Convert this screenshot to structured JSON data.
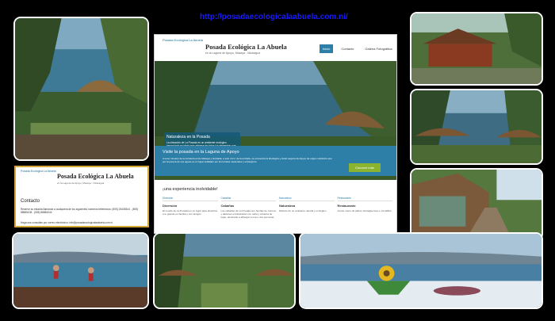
{
  "collage_url": "http://posadaecologicalaabuela.com.ni/",
  "website": {
    "top_line": "Posada Ecológica La Abuela",
    "title": "Posada Ecológica La Abuela",
    "subtitle": "en la Laguna de Apoyo, Masaya - Nicaragua",
    "nav": [
      "Inicio",
      "Contacto",
      "Galería Fotográfica"
    ],
    "hero_box": {
      "heading": "Naturaleza en la Posada",
      "text": "La ubicación de La Posada en un ambiente ecológico inmaculado es ideal para alejarse de todos los elementos que producen cansancio y estrés. Cuando esté aquí, olvidará"
    },
    "band": {
      "heading": "Visite la posada en la Laguna de Apoyo",
      "text": "A unos minutos de la carretera entre Masaya y Granada, a solo 4 km. de la entrada, se encuentra la Ecológica y Hotel Laguna de Apoyo de origen volcánico que por la pureza de sus aguas es un lugar señalado por los turistas nacionales y extranjeros.",
      "button": "Conocer más"
    },
    "experience_heading": "¡una experiencia inolvidable!",
    "columns": [
      {
        "category": "Diversión",
        "title": "Diversión",
        "text": "El muelle de La Posada es un lugar para divertirse a lo grande en familia y con amigos"
      },
      {
        "category": "Cabañas",
        "title": "Cabañas",
        "text": "Las cabañas de La Posada son hechas de troncos y tablones entrelazados con caña y cubierta de tejas, destinado a albergar a una o dos personas"
      },
      {
        "category": "Naturaleza",
        "title": "Naturaleza",
        "text": "Disfrute de un ambiente natural y ecológico"
      },
      {
        "category": "Restaurante",
        "title": "Restaurante",
        "text": "Ampio menu de platos nicaragüenses e Iorcalillos"
      }
    ]
  },
  "card": {
    "top_line": "Posada Ecológica La Abuela",
    "title": "Posada Ecológica La Abuela",
    "subtitle": "en la Laguna de Apoyo, Masaya - Nicaragua",
    "contact_heading": "Contacto",
    "contact_text": "Reserve su estadía llamando a cualquiera de los siguientes números telefónicos: (505) 25435344 - (505) 88885108 - (505) 88884044",
    "contact_mail": "Haga sus consultas por correo electrónico: info@posadaecologicalaabuela.com.ni"
  },
  "colors": {
    "url": "#1a1aff",
    "accent": "#2e7fa8",
    "button": "#8ab42f",
    "card_border": "#d4a93a"
  }
}
